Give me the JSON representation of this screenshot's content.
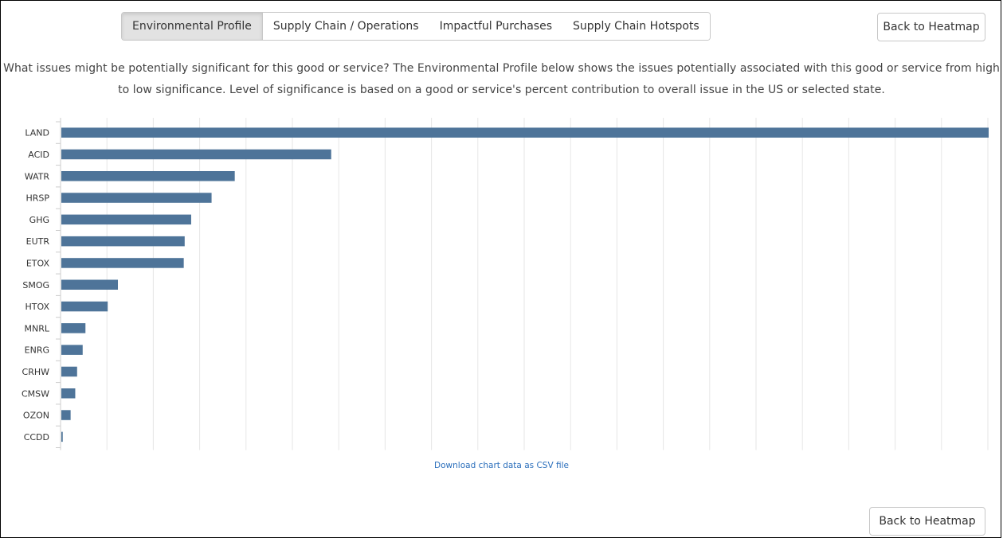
{
  "tabs": [
    {
      "label": "Environmental Profile",
      "active": true
    },
    {
      "label": "Supply Chain / Operations",
      "active": false
    },
    {
      "label": "Impactful Purchases",
      "active": false
    },
    {
      "label": "Supply Chain Hotspots",
      "active": false
    }
  ],
  "back_button_top": "Back to Heatmap",
  "description": "What issues might be potentially significant for this good or service? The Environmental Profile below shows the issues potentially associated with this good or service from high to low significance. Level of significance is based on a good or service's percent contribution to overall issue in the US or selected state.",
  "download_link": "Download chart data as CSV file",
  "back_button_bottom": "Back to Heatmap",
  "colors": {
    "bar": "#4e7499",
    "grid": "#e6e6e6",
    "axis": "#cccccc",
    "link": "#2a6ebb"
  },
  "chart_data": {
    "type": "bar",
    "orientation": "horizontal",
    "title": "",
    "xlabel": "",
    "ylabel": "",
    "xlim": [
      0,
      100
    ],
    "grid": true,
    "categories": [
      "LAND",
      "ACID",
      "WATR",
      "HRSP",
      "GHG",
      "EUTR",
      "ETOX",
      "SMOG",
      "HTOX",
      "MNRL",
      "ENRG",
      "CRHW",
      "CMSW",
      "OZON",
      "CCDD"
    ],
    "values": [
      100,
      29.1,
      18.7,
      16.2,
      14.0,
      13.3,
      13.2,
      6.1,
      5.0,
      2.6,
      2.3,
      1.7,
      1.5,
      1.0,
      0.15
    ]
  }
}
